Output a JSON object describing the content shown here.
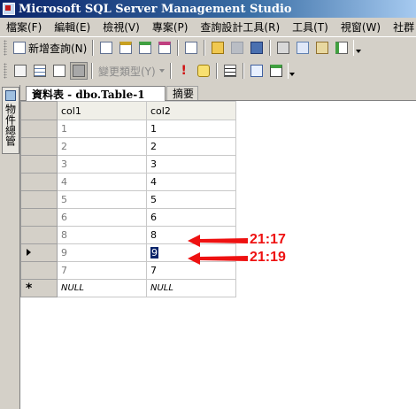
{
  "window": {
    "title": "Microsoft SQL Server Management Studio",
    "icon": "ssms-app-icon"
  },
  "menu": [
    "檔案(F)",
    "編輯(E)",
    "檢視(V)",
    "專案(P)",
    "查詢設計工具(R)",
    "工具(T)",
    "視窗(W)",
    "社群"
  ],
  "toolbar1": {
    "new_query_label": "新增查詢(N)",
    "icons": [
      "new-query-icon",
      "new-file-icon",
      "mdx-query-icon",
      "dmx-query-icon",
      "xmla-query-icon",
      "new-database-query-icon",
      "open-file-icon",
      "save-icon",
      "save-all-icon",
      "registered-servers-icon",
      "object-explorer-icon",
      "template-explorer-icon",
      "properties-icon"
    ]
  },
  "toolbar2": {
    "change_type_label": "變更類型(Y)",
    "icons": [
      "show-diagram-pane-icon",
      "show-criteria-pane-icon",
      "show-sql-pane-icon",
      "show-results-pane-icon",
      "execute-sql-icon",
      "verify-sql-icon",
      "group-by-icon",
      "add-table-icon",
      "add-new-derived-table-icon"
    ]
  },
  "side_panel": {
    "label": "物件總管",
    "pin_icon": "pin-icon"
  },
  "tabs": [
    {
      "label": "資料表 - dbo.Table-1",
      "active": true
    },
    {
      "label": "摘要",
      "active": false
    }
  ],
  "grid": {
    "columns": [
      "col1",
      "col2"
    ],
    "rows": [
      {
        "col1": "1",
        "col2": "1",
        "marker": ""
      },
      {
        "col1": "2",
        "col2": "2",
        "marker": ""
      },
      {
        "col1": "3",
        "col2": "3",
        "marker": ""
      },
      {
        "col1": "4",
        "col2": "4",
        "marker": ""
      },
      {
        "col1": "5",
        "col2": "5",
        "marker": ""
      },
      {
        "col1": "6",
        "col2": "6",
        "marker": ""
      },
      {
        "col1": "8",
        "col2": "8",
        "marker": ""
      },
      {
        "col1": "9",
        "col2": "9",
        "marker": "current"
      },
      {
        "col1": "7",
        "col2": "7",
        "marker": ""
      }
    ],
    "new_row": {
      "col1": "NULL",
      "col2": "NULL",
      "marker": "*"
    }
  },
  "annotations": [
    {
      "text": "21:17",
      "color": "#ee1111"
    },
    {
      "text": "21:19",
      "color": "#ee1111"
    }
  ]
}
